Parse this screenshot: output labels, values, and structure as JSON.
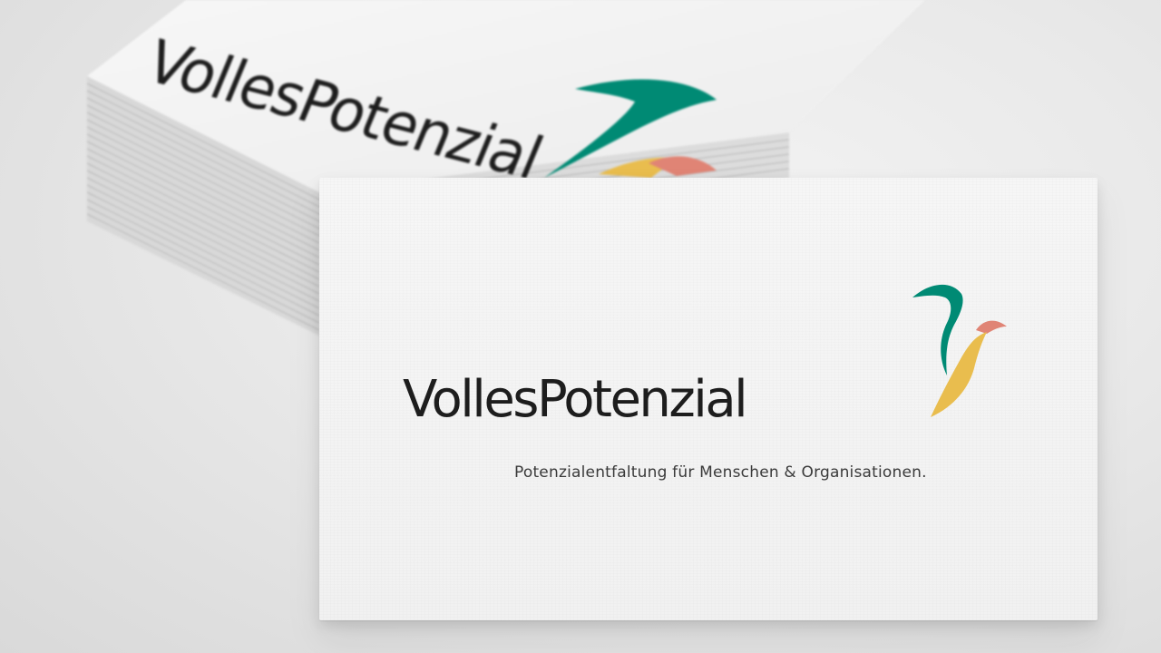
{
  "brand": {
    "name": "VollesPotenzial",
    "tagline": "Potenzialentfaltung für Menschen & Organisationen."
  },
  "colors": {
    "teal": "#008a74",
    "yellow": "#e9bd4e",
    "coral": "#e08475",
    "text": "#1d1d1d",
    "card": "#f4f4f4"
  },
  "icons": [
    "logo-mark-icon"
  ]
}
